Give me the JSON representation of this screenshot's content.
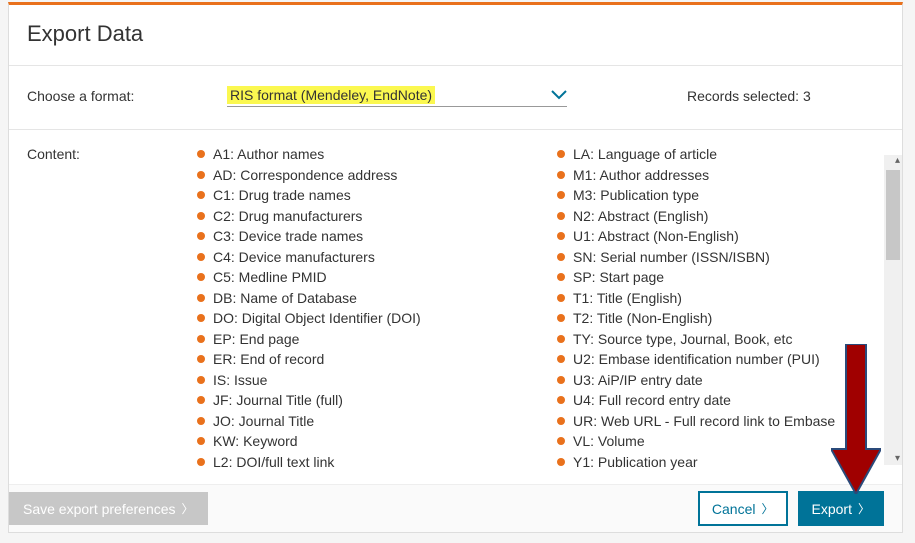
{
  "title": "Export Data",
  "format": {
    "label": "Choose a format:",
    "value": "RIS format (Mendeley, EndNote)"
  },
  "records": {
    "label": "Records selected:",
    "count": "3"
  },
  "content": {
    "label": "Content:",
    "col1": [
      "A1: Author names",
      "AD: Correspondence address",
      "C1: Drug trade names",
      "C2: Drug manufacturers",
      "C3: Device trade names",
      "C4: Device manufacturers",
      "C5: Medline PMID",
      "DB: Name of Database",
      "DO: Digital Object Identifier (DOI)",
      "EP: End page",
      "ER: End of record",
      "IS: Issue",
      "JF: Journal Title (full)",
      "JO: Journal Title",
      "KW: Keyword",
      "L2: DOI/full text link"
    ],
    "col2": [
      "LA: Language of article",
      "M1: Author addresses",
      "M3: Publication type",
      "N2: Abstract (English)",
      "U1: Abstract (Non-English)",
      "SN: Serial number (ISSN/ISBN)",
      "SP: Start page",
      "T1: Title (English)",
      "T2: Title (Non-English)",
      "TY: Source type, Journal, Book, etc",
      "U2: Embase identification number (PUI)",
      "U3: AiP/IP entry date",
      "U4: Full record entry date",
      "UR: Web URL - Full record link to Embase",
      "VL: Volume",
      "Y1: Publication year"
    ]
  },
  "buttons": {
    "save_pref": "Save export preferences",
    "cancel": "Cancel",
    "export": "Export"
  }
}
